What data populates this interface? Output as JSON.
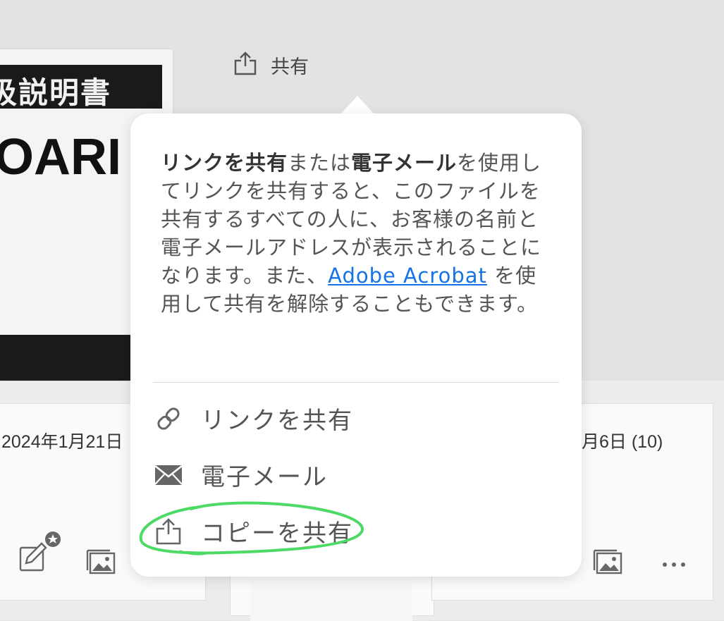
{
  "header": {
    "share_label": "共有"
  },
  "document": {
    "title_fragment": "扱説明書",
    "big_text_fragment": "OARI"
  },
  "cards": [
    {
      "date": "2024年1月21日"
    },
    {
      "date": ""
    },
    {
      "date": "月6日 (10)"
    }
  ],
  "popover": {
    "text_bold_1": "リンクを共有",
    "text_1": "または",
    "text_bold_2": "電子メール",
    "text_2": "を使用してリンクを共有すると、このファイルを共有するすべての人に、お客様の名前と電子メールアドレスが表示されることになります。また、",
    "link_text": "Adobe Acrobat",
    "text_3": " を使用して共有を解除することもできます。",
    "menu": [
      {
        "label": "リンクを共有",
        "icon": "link-icon"
      },
      {
        "label": "電子メール",
        "icon": "email-icon"
      },
      {
        "label": "コピーを共有",
        "icon": "share-icon"
      }
    ]
  },
  "colors": {
    "link": "#1473e6",
    "highlight": "#4cd964"
  }
}
